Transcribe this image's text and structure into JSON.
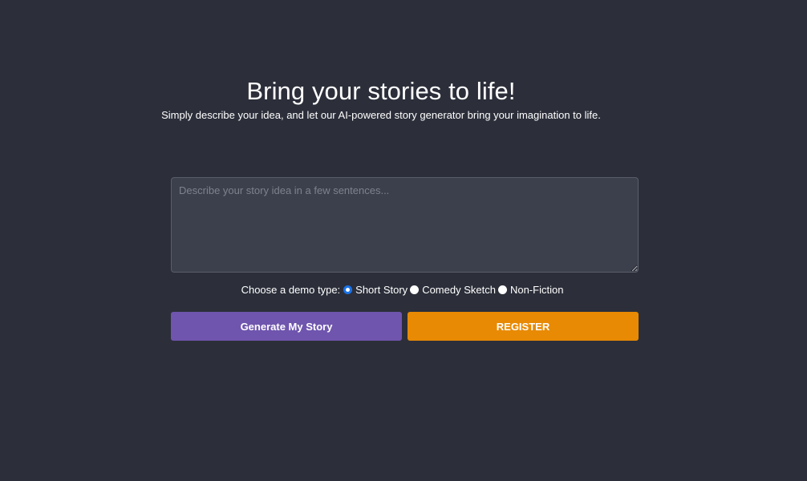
{
  "hero": {
    "title": "Bring your stories to life!",
    "subtitle": "Simply describe your idea, and let our AI-powered story generator bring your imagination to life."
  },
  "story": {
    "value": "",
    "placeholder": "Describe your story idea in a few sentences..."
  },
  "demo": {
    "label": "Choose a demo type:",
    "options": [
      {
        "label": "Short Story",
        "selected": true
      },
      {
        "label": "Comedy Sketch",
        "selected": false
      },
      {
        "label": "Non-Fiction",
        "selected": false
      }
    ]
  },
  "buttons": {
    "generate_label": "Generate My Story",
    "register_label": "REGISTER"
  },
  "colors": {
    "background": "#2c2f3a",
    "generate_button": "#6f55ae",
    "register_button": "#e88a03",
    "radio_selected": "#1a73e8"
  }
}
